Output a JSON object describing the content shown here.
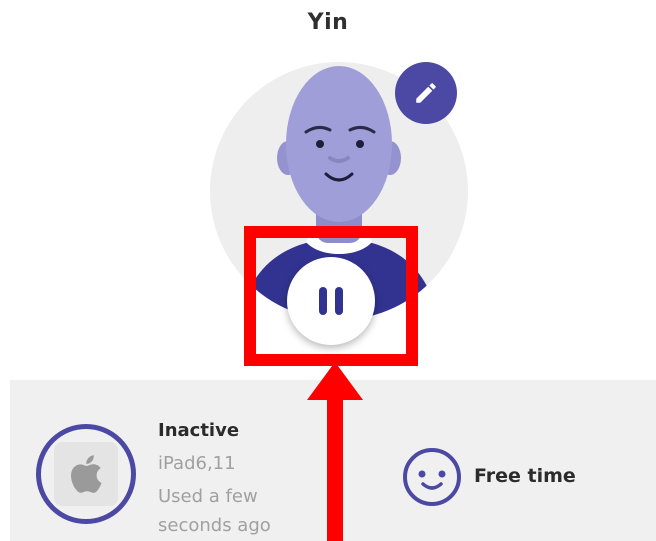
{
  "profile": {
    "name": "Yin"
  },
  "device": {
    "status": "Inactive",
    "model": "iPad6,11",
    "last_used": "Used a few seconds ago",
    "platform_icon": "apple-logo-icon"
  },
  "mode": {
    "label": "Free time",
    "icon": "smiley-face-icon"
  },
  "icons": {
    "edit": "pencil-icon",
    "pause": "pause-icon"
  },
  "colors": {
    "accent": "#4b49a3",
    "avatar_skin": "#a09ed8",
    "annotation": "#ff0000",
    "panel_bg": "#f0f0f0",
    "muted_text": "#a0a0a0"
  }
}
